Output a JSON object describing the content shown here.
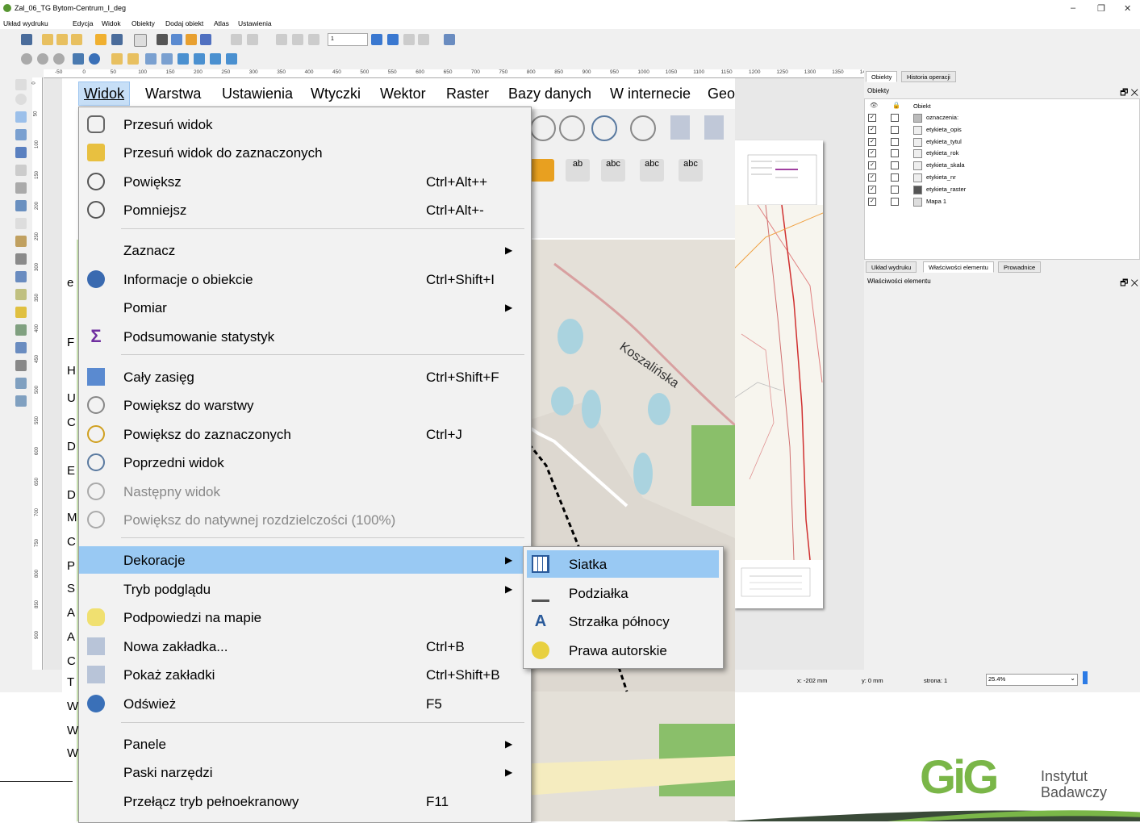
{
  "layout_window": {
    "title": "Zal_06_TG Bytom-Centrum_I_deg",
    "menu": [
      "Układ wydruku",
      "Edycja",
      "Widok",
      "Obiekty",
      "Dodaj obiekt",
      "Atlas",
      "Ustawienia"
    ],
    "page_spin_value": "1",
    "ruler_top": [
      "-50",
      "0",
      "50",
      "100",
      "150",
      "200",
      "250",
      "300",
      "350",
      "400",
      "450",
      "500",
      "550",
      "600",
      "650",
      "700",
      "750",
      "800",
      "850",
      "900",
      "950",
      "1000",
      "1050",
      "1100",
      "1150",
      "1200",
      "1250",
      "1300",
      "1350",
      "14"
    ],
    "ruler_left": [
      "0",
      "50",
      "100",
      "150",
      "200",
      "250",
      "300",
      "350",
      "400",
      "450",
      "500",
      "550",
      "600",
      "650",
      "700",
      "750",
      "800",
      "850",
      "900"
    ],
    "status": {
      "x": "x: -202 mm",
      "y": "y: 0 mm",
      "page": "strona: 1",
      "zoom": "25.4%"
    }
  },
  "right_panel": {
    "tabs_top": [
      "Obiekty",
      "Historia operacji"
    ],
    "items_title": "Obiekty",
    "items_header": "Obiekt",
    "items": [
      {
        "label": "oznaczenia:",
        "icon": "legend-icon"
      },
      {
        "label": "etykieta_opis",
        "icon": "text-icon"
      },
      {
        "label": "etykieta_tytul",
        "icon": "text-icon"
      },
      {
        "label": "etykieta_rok",
        "icon": "text-icon"
      },
      {
        "label": "etykieta_skala",
        "icon": "text-icon"
      },
      {
        "label": "etykieta_nr",
        "icon": "text-icon"
      },
      {
        "label": "etykieta_raster",
        "icon": "picture-icon"
      },
      {
        "label": "Mapa 1",
        "icon": "map-icon"
      }
    ],
    "tabs_bottom": [
      "Układ wydruku",
      "Właściwości elementu",
      "Prowadnice"
    ],
    "props_title": "Właściwości elementu"
  },
  "map_window": {
    "menubar": [
      "Widok",
      "Warstwa",
      "Ustawienia",
      "Wtyczki",
      "Wektor",
      "Raster",
      "Bazy danych",
      "W internecie",
      "Geo"
    ],
    "left_letters": [
      "e",
      "F",
      "H",
      "U",
      "C",
      "D",
      "E",
      "D",
      "M",
      "C",
      "P",
      "S",
      "A",
      "A",
      "C",
      "T",
      "W",
      "W",
      "W"
    ],
    "street_label": "Koszalińska"
  },
  "menu": {
    "items": [
      {
        "label": "Przesuń widok",
        "shortcut": "",
        "submenu": false,
        "icon": "pan-hand-icon"
      },
      {
        "label": "Przesuń widok do zaznaczonych",
        "shortcut": "",
        "submenu": false,
        "icon": "pan-to-selection-icon"
      },
      {
        "label": "Powiększ",
        "shortcut": "Ctrl+Alt++",
        "submenu": false,
        "icon": "zoom-in-icon"
      },
      {
        "label": "Pomniejsz",
        "shortcut": "Ctrl+Alt+-",
        "submenu": false,
        "icon": "zoom-out-icon"
      },
      {
        "label": "Zaznacz",
        "shortcut": "",
        "submenu": true,
        "icon": ""
      },
      {
        "label": "Informacje o obiekcie",
        "shortcut": "Ctrl+Shift+I",
        "submenu": false,
        "icon": "identify-icon"
      },
      {
        "label": "Pomiar",
        "shortcut": "",
        "submenu": true,
        "icon": ""
      },
      {
        "label": "Podsumowanie statystyk",
        "shortcut": "",
        "submenu": false,
        "icon": "sigma-icon"
      },
      {
        "label": "Cały zasięg",
        "shortcut": "Ctrl+Shift+F",
        "submenu": false,
        "icon": "full-extent-icon"
      },
      {
        "label": "Powiększ do warstwy",
        "shortcut": "",
        "submenu": false,
        "icon": "zoom-layer-icon"
      },
      {
        "label": "Powiększ do zaznaczonych",
        "shortcut": "Ctrl+J",
        "submenu": false,
        "icon": "zoom-selected-icon"
      },
      {
        "label": "Poprzedni widok",
        "shortcut": "",
        "submenu": false,
        "icon": "zoom-last-icon"
      },
      {
        "label": "Następny widok",
        "shortcut": "",
        "submenu": false,
        "icon": "zoom-next-icon"
      },
      {
        "label": "Powiększ do natywnej rozdzielczości (100%)",
        "shortcut": "",
        "submenu": false,
        "icon": "zoom-actual-icon"
      },
      {
        "label": "Dekoracje",
        "shortcut": "",
        "submenu": true,
        "icon": ""
      },
      {
        "label": "Tryb podglądu",
        "shortcut": "",
        "submenu": true,
        "icon": ""
      },
      {
        "label": "Podpowiedzi na mapie",
        "shortcut": "",
        "submenu": false,
        "icon": "map-tips-icon"
      },
      {
        "label": "Nowa zakładka...",
        "shortcut": "Ctrl+B",
        "submenu": false,
        "icon": "new-bookmark-icon"
      },
      {
        "label": "Pokaż zakładki",
        "shortcut": "Ctrl+Shift+B",
        "submenu": false,
        "icon": "show-bookmarks-icon"
      },
      {
        "label": "Odśwież",
        "shortcut": "F5",
        "submenu": false,
        "icon": "refresh-icon"
      },
      {
        "label": "Panele",
        "shortcut": "",
        "submenu": true,
        "icon": ""
      },
      {
        "label": "Paski narzędzi",
        "shortcut": "",
        "submenu": true,
        "icon": ""
      },
      {
        "label": "Przełącz tryb pełnoekranowy",
        "shortcut": "F11",
        "submenu": false,
        "icon": ""
      }
    ],
    "submenu": [
      {
        "label": "Siatka",
        "icon": "grid-icon"
      },
      {
        "label": "Podziałka",
        "icon": "scale-bar-icon"
      },
      {
        "label": "Strzałka północy",
        "icon": "north-arrow-icon"
      },
      {
        "label": "Prawa autorskie",
        "icon": "copyright-icon"
      }
    ]
  },
  "logo": {
    "text1": "Instytut",
    "text2": "Badawczy",
    "letters": "GiG"
  },
  "colors": {
    "highlight": "#99c9f3",
    "logo_green": "#7ab648",
    "map_green": "#cfe8b6"
  }
}
